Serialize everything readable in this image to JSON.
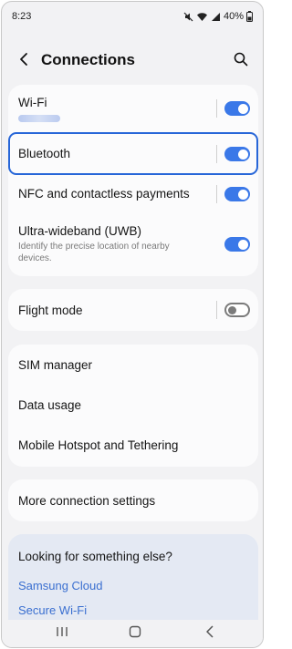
{
  "status_bar": {
    "time": "8:23",
    "battery": "40%",
    "icons": [
      "mute-icon",
      "wifi-icon",
      "signal-icon",
      "battery-icon"
    ]
  },
  "header": {
    "title": "Connections",
    "back_icon": "chevron-left-icon",
    "search_icon": "search-icon"
  },
  "sections": {
    "wireless": [
      {
        "label": "Wi-Fi",
        "subtitle_blurred": true,
        "toggle": "on"
      },
      {
        "label": "Bluetooth",
        "toggle": "on",
        "highlighted": true
      },
      {
        "label": "NFC and contactless payments",
        "toggle": "on"
      },
      {
        "label": "Ultra-wideband (UWB)",
        "subtitle": "Identify the precise location of nearby devices.",
        "toggle": "on"
      }
    ],
    "flight": {
      "label": "Flight mode",
      "toggle": "off"
    },
    "network": [
      {
        "label": "SIM manager"
      },
      {
        "label": "Data usage"
      },
      {
        "label": "Mobile Hotspot and Tethering"
      }
    ],
    "more": {
      "label": "More connection settings"
    }
  },
  "suggestions": {
    "title": "Looking for something else?",
    "links": [
      "Samsung Cloud",
      "Secure Wi-Fi"
    ]
  },
  "navbar": {
    "icons": [
      "recents-icon",
      "home-icon",
      "back-icon"
    ]
  },
  "colors": {
    "accent": "#3a78e8",
    "highlight": "#2766d8",
    "link": "#3a6fd0",
    "background": "#f2f2f4",
    "card": "#fbfbfc",
    "suggest_card": "#e4e9f3"
  }
}
